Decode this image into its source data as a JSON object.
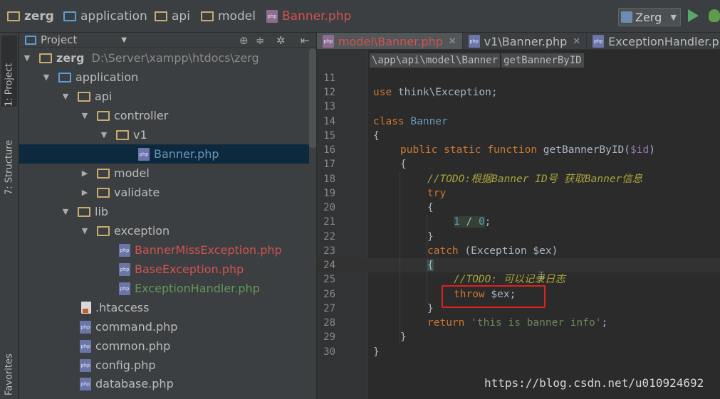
{
  "navbar": {
    "crumbs": [
      "zerg",
      "application",
      "api",
      "model",
      "Banner.php"
    ],
    "run_config": "Zerg",
    "icons": [
      "folder-icon",
      "php-file-icon",
      "run-icon",
      "debug-icon"
    ]
  },
  "toolstrip": {
    "project_tab": "1: Project",
    "structure_tab": "7: Structure",
    "favorites_tab": "Favorites"
  },
  "project_panel": {
    "view_label": "Project",
    "tree": [
      {
        "label": "zerg",
        "path": "D:\\Server\\xampp\\htdocs\\zerg",
        "expanded": true
      },
      {
        "label": "application",
        "expanded": true
      },
      {
        "label": "api",
        "expanded": true
      },
      {
        "label": "controller",
        "expanded": true
      },
      {
        "label": "v1",
        "expanded": true
      },
      {
        "label": "Banner.php",
        "selected": true
      },
      {
        "label": "model",
        "expanded": false
      },
      {
        "label": "validate",
        "expanded": false
      },
      {
        "label": "lib",
        "expanded": true
      },
      {
        "label": "exception",
        "expanded": true
      },
      {
        "label": "BannerMissException.php"
      },
      {
        "label": "BaseException.php"
      },
      {
        "label": "ExceptionHandler.php"
      },
      {
        "label": ".htaccess"
      },
      {
        "label": "command.php"
      },
      {
        "label": "common.php"
      },
      {
        "label": "config.php"
      },
      {
        "label": "database.php"
      }
    ]
  },
  "editor": {
    "tabs": [
      "model\\Banner.php",
      "v1\\Banner.php",
      "ExceptionHandler.php"
    ],
    "breadcrumb": [
      "\\app\\api\\model\\Banner",
      "getBannerByID"
    ],
    "line_numbers": [
      "11",
      "12",
      "13",
      "14",
      "15",
      "16",
      "17",
      "18",
      "19",
      "20",
      "21",
      "22",
      "23",
      "24",
      "25",
      "26",
      "27",
      "28",
      "29",
      "30"
    ],
    "code": {
      "l12_use": "use",
      "l12_rest": " think\\Exception;",
      "l14_class": "class",
      "l14_name": " Banner",
      "l15": "{",
      "l16_mods": "public static function",
      "l16_name": " getBannerByID(",
      "l16_var": "$id",
      "l16_end": ")",
      "l17": "{",
      "l18_comment": "//TODO:根据Banner ID号 获取Banner信息",
      "l19_try": "try",
      "l20": "{",
      "l21_a": "1",
      "l21_op": " / ",
      "l21_b": "0",
      "l21_end": ";",
      "l22": "}",
      "l23_catch": "catch",
      "l23_rest": " (Exception $ex)",
      "l24": "{",
      "l25_comment": "//TODO: 可以记录日志",
      "l26_throw": "throw",
      "l26_rest": " $ex;",
      "l27": "}",
      "l28_return": "return",
      "l28_str": " 'this is banner info'",
      "l28_end": ";",
      "l29": "}",
      "l30": "}"
    }
  },
  "watermark": "https://blog.csdn.net/u010924692",
  "colors": {
    "keyword": "#cc7832",
    "string": "#6a8759",
    "number": "#6897bb",
    "comment_todo": "#a8a33b",
    "highlight_box": "#e22020"
  }
}
